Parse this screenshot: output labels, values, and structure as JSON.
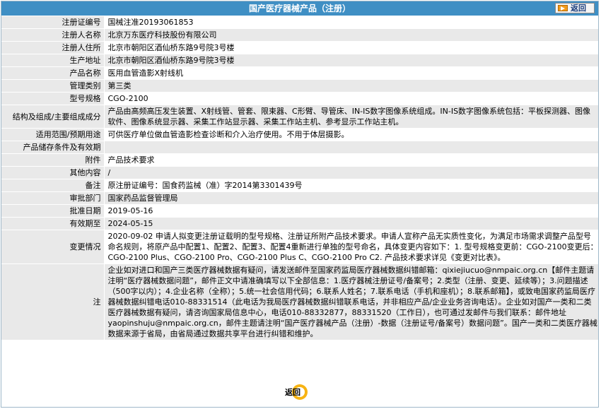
{
  "header": {
    "title": "国产医疗器械产品（注册）",
    "back_label": "返回"
  },
  "rows": [
    {
      "label": "注册证编号",
      "value": "国械注准20193061853"
    },
    {
      "label": "注册人名称",
      "value": "北京万东医疗科技股份有限公司"
    },
    {
      "label": "注册人住所",
      "value": "北京市朝阳区酒仙桥东路9号院3号楼"
    },
    {
      "label": "生产地址",
      "value": "北京市朝阳区酒仙桥东路9号院3号楼"
    },
    {
      "label": "产品名称",
      "value": "医用血管造影X射线机"
    },
    {
      "label": "管理类别",
      "value": "第三类"
    },
    {
      "label": "型号规格",
      "value": "CGO-2100"
    },
    {
      "label": "结构及组成/主要组成成分",
      "value": "产品由高频高压发生装置、X射线管、管套、限束器、C形臂、导管床、IN-IS数字图像系统组成。IN-IS数字图像系统包括：平板探测器、图像软件、图像系统显示器、采集工作站显示器、采集工作站主机、参考显示工作站主机。"
    },
    {
      "label": "适用范围/预期用途",
      "value": "可供医疗单位做血管造影检查诊断和介入治疗使用。不用于体层摄影。"
    },
    {
      "label": "产品储存条件及有效期",
      "value": ""
    },
    {
      "label": "附件",
      "value": "产品技术要求"
    },
    {
      "label": "其他内容",
      "value": "/"
    },
    {
      "label": "备注",
      "value": "原注册证编号：国食药监械（准）字2014第3301439号"
    },
    {
      "label": "审批部门",
      "value": "国家药品监督管理局"
    },
    {
      "label": "批准日期",
      "value": "2019-05-16"
    },
    {
      "label": "有效期至",
      "value": "2024-05-15"
    },
    {
      "label": "变更情况",
      "value": "2020-09-02 申请人拟变更注册证载明的型号规格、注册证所附产品技术要求。申请人宣称产品无实质性变化，为满足市场需求调整产品型号命名规则，将原产品中配置1、配置2、配置3、配置4重新进行单独的型号命名，具体变更内容如下：1. 型号规格变更前：CGO-2100变更后：CGO-2100 Plus、CGO-2100 Pro、CGO-2100 Plus C、CGO-2100 Pro C2. 产品技术要求详见《变更对比表》。"
    },
    {
      "label": "注",
      "value": "企业如对进口和国产三类医疗器械数据有疑问，请发送邮件至国家药监局医疗器械数据纠错邮箱：qixiejiucuo@nmpaic.org.cn【邮件主题请注明“医疗器械数据问题”，邮件正文中请准确填写以下全部信息：1.医疗器械注册证号/备案号；2.类型（注册、变更、延续等）；3.问题描述（500字以内）；4.企业名称（全称）；5.统一社会信用代码；6.联系人姓名；7.联系电话（手机和座机）；8.联系邮箱】，或致电国家药监局医疗器械数据纠错电话010-88331514（此电话为我局医疗器械数据纠错联系电话，并非相应产品/企业业务咨询电话）。企业如对国产一类和二类医疗器械数据有疑问，请咨询国家局信息中心，电话010-88332877，88331520（工作日），也可通过发邮件与我们联系：邮件地址yaopinshuju@nmpaic.org.cn，邮件主题请注明“国产医疗器械产品（注册）-数据（注册证号/备案号）数据问题”。国产一类和二类医疗器械数据来源于省局，由省局通过数据共享平台进行纠错和维护。"
    }
  ],
  "footer": {
    "back_label": "返回"
  },
  "colors": {
    "title_bar": "#3f8fc4",
    "label_bg": "#e9e9e9",
    "accent_orange": "#f7b313"
  }
}
